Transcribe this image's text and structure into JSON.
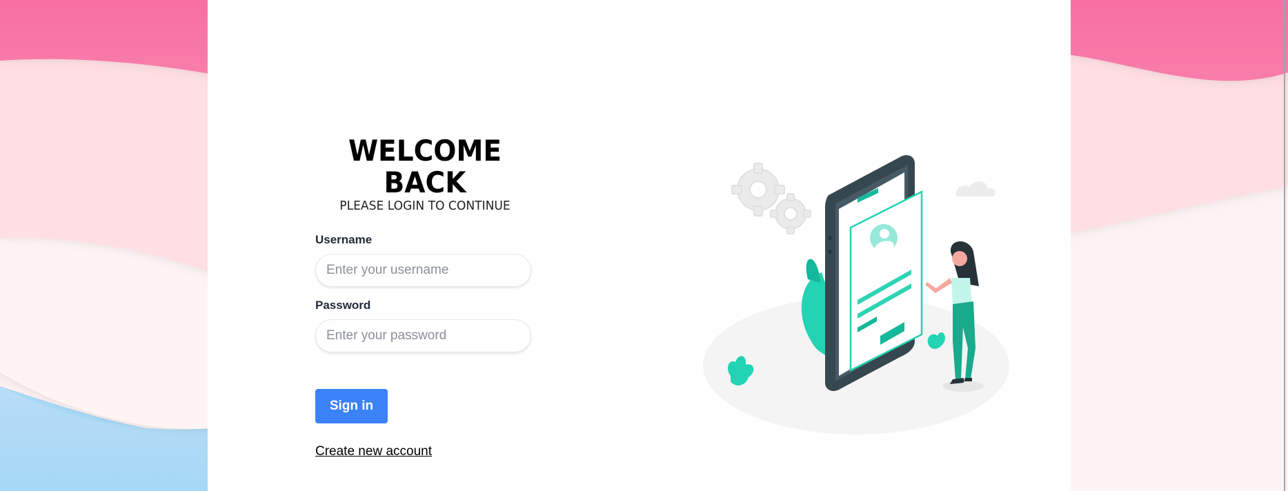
{
  "heading": {
    "title": "WELCOME BACK",
    "subtitle": "PLEASE LOGIN TO CONTINUE"
  },
  "form": {
    "username_label": "Username",
    "username_placeholder": "Enter your username",
    "username_value": "",
    "password_label": "Password",
    "password_placeholder": "Enter your password",
    "password_value": "",
    "signin_label": "Sign in",
    "create_account_label": "Create new account"
  },
  "colors": {
    "accent": "#3b82f6",
    "illustration_teal": "#2dd4b4",
    "background_pink": "#f472a6"
  },
  "icons": {
    "illustration": "mobile-login-illustration"
  }
}
